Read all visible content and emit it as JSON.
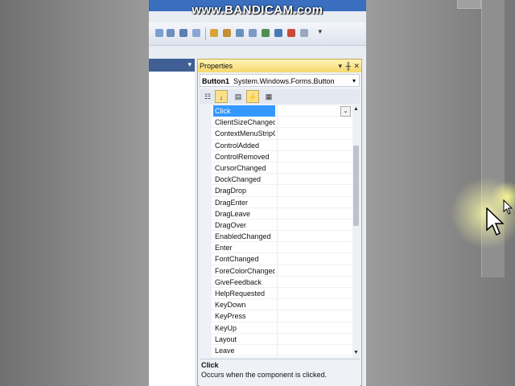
{
  "watermark": "www.BANDICAM.com",
  "properties": {
    "title": "Properties",
    "object_name": "Button1",
    "object_type": "System.Windows.Forms.Button",
    "events": [
      "Click",
      "ClientSizeChanged",
      "ContextMenuStripC",
      "ControlAdded",
      "ControlRemoved",
      "CursorChanged",
      "DockChanged",
      "DragDrop",
      "DragEnter",
      "DragLeave",
      "DragOver",
      "EnabledChanged",
      "Enter",
      "FontChanged",
      "ForeColorChanged",
      "GiveFeedback",
      "HelpRequested",
      "KeyDown",
      "KeyPress",
      "KeyUp",
      "Layout",
      "Leave"
    ],
    "selected_event_index": 0,
    "description_title": "Click",
    "description_text": "Occurs when the component is clicked."
  },
  "colors": {
    "titlebar": "#3a6fbf",
    "selection": "#3399ff",
    "panel_title": "#f6d86a"
  }
}
